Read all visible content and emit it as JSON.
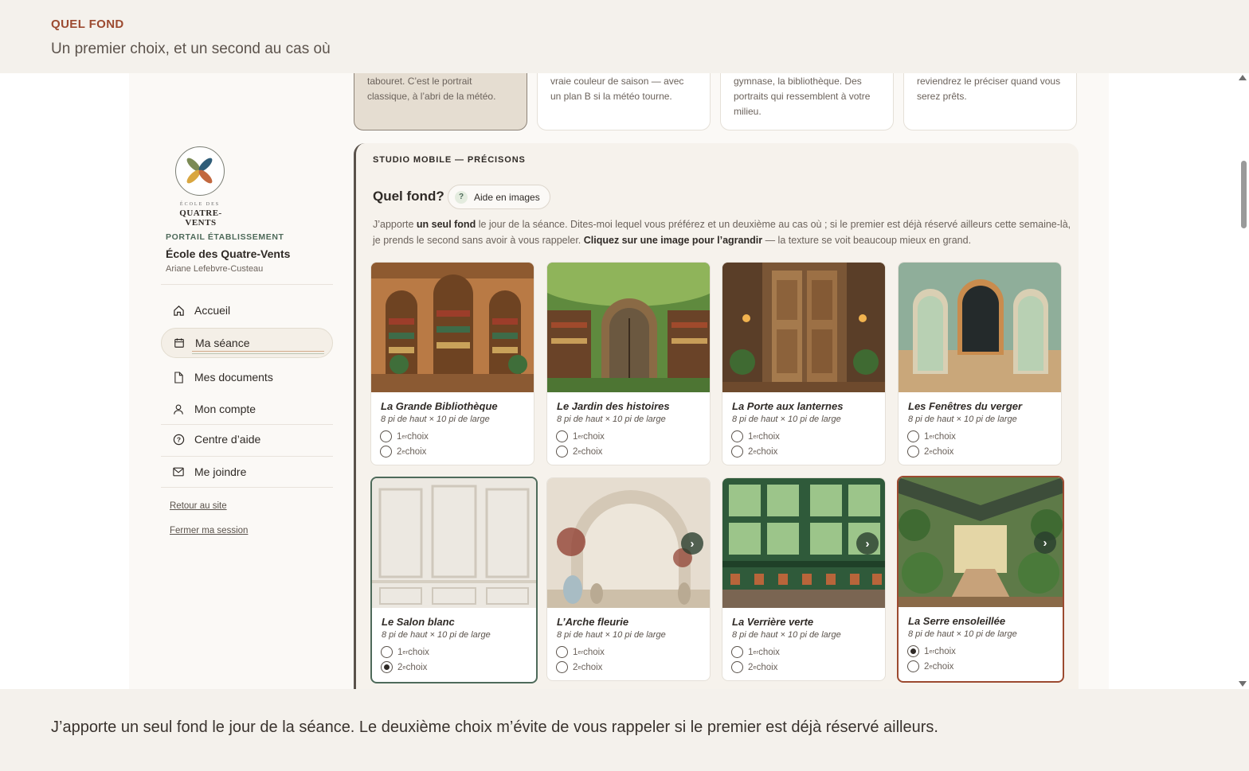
{
  "header": {
    "eyebrow": "QUEL FOND",
    "subtitle": "Un premier choix, et un second au cas où"
  },
  "footer": {
    "note": "J’apporte un seul fond le jour de la séance. Le deuxième choix m’évite de vous rappeler si le premier est déjà réservé ailleurs."
  },
  "sidebar": {
    "logo_small": "ÉCOLE DES",
    "logo_name": "QUATRE-VENTS",
    "portal_label": "PORTAIL ÉTABLISSEMENT",
    "school_name": "École des Quatre-Vents",
    "user_name": "Ariane Lefebvre-Custeau",
    "nav": [
      {
        "label": "Accueil",
        "icon": "home-icon"
      },
      {
        "label": "Ma séance",
        "icon": "calendar-icon",
        "active": true
      },
      {
        "label": "Mes documents",
        "icon": "document-icon"
      },
      {
        "label": "Mon compte",
        "icon": "user-icon"
      },
      {
        "label": "Centre d’aide",
        "icon": "help-icon"
      },
      {
        "label": "Me joindre",
        "icon": "mail-icon"
      }
    ],
    "back_link": "Retour au site",
    "logout_link": "Fermer ma session"
  },
  "location_options": [
    {
      "text": "tabouret. C’est le portrait classique, à l’abri de la météo."
    },
    {
      "text": "vraie couleur de saison — avec un plan B si la météo tourne."
    },
    {
      "text": "gymnase, la bibliothèque. Des portraits qui ressemblent à votre milieu."
    },
    {
      "text": "reviendrez le préciser quand vous serez prêts."
    }
  ],
  "panel": {
    "eyebrow": "STUDIO MOBILE — PRÉCISONS",
    "question": "Quel fond?",
    "help_button": "Aide en images",
    "help_q": "?",
    "intro_1": "J’apporte ",
    "intro_bold_1": "un seul fond",
    "intro_2": " le jour de la séance. Dites-moi lequel vous préférez et un deuxième au cas où ; si le premier est déjà réservé ailleurs cette semaine-là, je prends le second sans avoir à vous rappeler. ",
    "intro_bold_2": "Cliquez sur une image pour l’agrandir",
    "intro_3": " — la texture se voit beaucoup mieux en grand."
  },
  "choice_labels": {
    "first_num": "1",
    "first_sup": "er",
    "second_num": "2",
    "second_sup": "e",
    "suffix": " choix",
    "next": "›"
  },
  "backdrops": [
    {
      "name": "La Grande Bibliothèque",
      "dims": "8 pi de haut × 10 pi de large",
      "choice": "none"
    },
    {
      "name": "Le Jardin des histoires",
      "dims": "8 pi de haut × 10 pi de large",
      "choice": "none"
    },
    {
      "name": "La Porte aux lanternes",
      "dims": "8 pi de haut × 10 pi de large",
      "choice": "none"
    },
    {
      "name": "Les Fenêtres du verger",
      "dims": "8 pi de haut × 10 pi de large",
      "choice": "none"
    },
    {
      "name": "Le Salon blanc",
      "dims": "8 pi de haut × 10 pi de large",
      "choice": "second"
    },
    {
      "name": "L’Arche fleurie",
      "dims": "8 pi de haut × 10 pi de large",
      "choice": "none"
    },
    {
      "name": "La Verrière verte",
      "dims": "8 pi de haut × 10 pi de large",
      "choice": "none"
    },
    {
      "name": "La Serre ensoleillée",
      "dims": "8 pi de haut × 10 pi de large",
      "choice": "first"
    }
  ],
  "colors": {
    "accent_rust": "#9c4a30",
    "accent_green": "#4e6a5a",
    "background": "#f4f1ec"
  }
}
